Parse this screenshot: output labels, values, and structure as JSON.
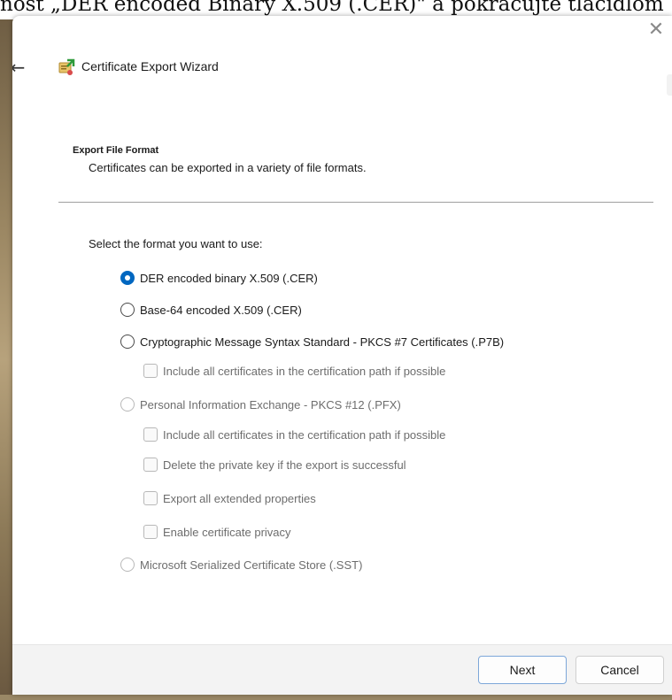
{
  "background": {
    "document_text": "nost „DER encoded Binary X.509 (.CER)\" a pokračujte tlačidlom"
  },
  "dialog": {
    "title": "Certificate Export Wizard",
    "icons": {
      "back": "back-arrow-icon",
      "close": "close-icon",
      "wizard": "certificate-icon"
    },
    "section": {
      "heading": "Export File Format",
      "description": "Certificates can be exported in a variety of file formats."
    },
    "prompt": "Select the format you want to use:",
    "options": [
      {
        "label": "DER encoded binary X.509 (.CER)",
        "type": "radio",
        "checked": true,
        "enabled": true
      },
      {
        "label": "Base-64 encoded X.509 (.CER)",
        "type": "radio",
        "checked": false,
        "enabled": true
      },
      {
        "label": "Cryptographic Message Syntax Standard - PKCS #7 Certificates (.P7B)",
        "type": "radio",
        "checked": false,
        "enabled": true
      },
      {
        "label": "Include all certificates in the certification path if possible",
        "type": "checkbox",
        "checked": false,
        "enabled": false
      },
      {
        "label": "Personal Information Exchange - PKCS #12 (.PFX)",
        "type": "radio",
        "checked": false,
        "enabled": false
      },
      {
        "label": "Include all certificates in the certification path if possible",
        "type": "checkbox",
        "checked": false,
        "enabled": false
      },
      {
        "label": "Delete the private key if the export is successful",
        "type": "checkbox",
        "checked": false,
        "enabled": false
      },
      {
        "label": "Export all extended properties",
        "type": "checkbox",
        "checked": false,
        "enabled": false
      },
      {
        "label": "Enable certificate privacy",
        "type": "checkbox",
        "checked": false,
        "enabled": false
      },
      {
        "label": "Microsoft Serialized Certificate Store (.SST)",
        "type": "radio",
        "checked": false,
        "enabled": false
      }
    ],
    "buttons": {
      "next": "Next",
      "cancel": "Cancel"
    },
    "colors": {
      "accent": "#0067c0",
      "disabled_text": "#6d6d6d"
    }
  }
}
